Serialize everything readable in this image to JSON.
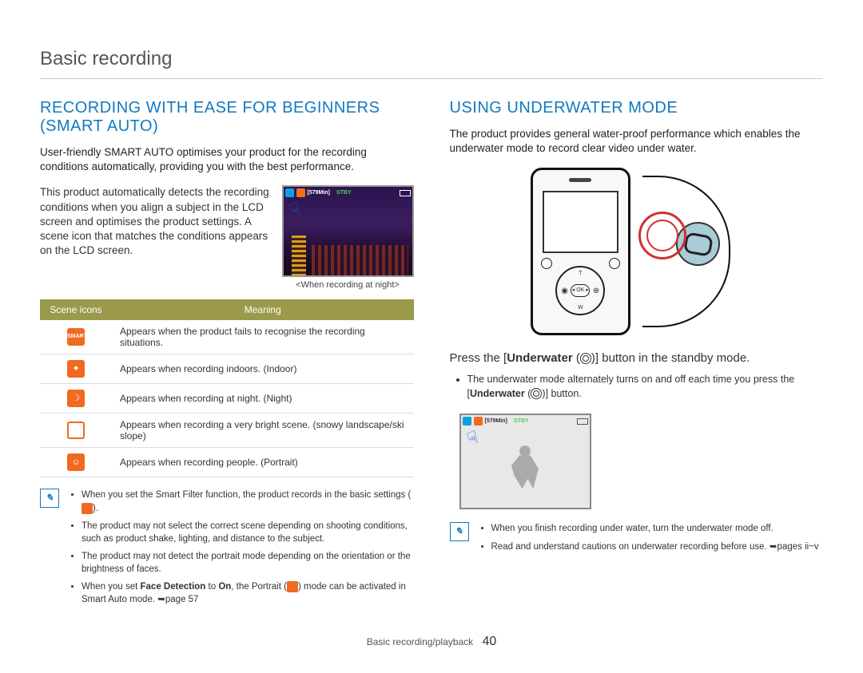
{
  "page_title": "Basic recording",
  "left": {
    "heading": "RECORDING WITH EASE FOR BEGINNERS (SMART AUTO)",
    "intro": "User-friendly SMART AUTO optimises your product for the recording conditions automatically, providing you with the best performance.",
    "auto_detect_text": "This product automatically detects the recording conditions when you align a subject in the LCD screen and optimises the product settings. A scene icon that matches the conditions appears on the LCD screen.",
    "lcd": {
      "time": "[579Min]",
      "stby": "STBY"
    },
    "caption": "<When recording at night>",
    "table": {
      "header1": "Scene icons",
      "header2": "Meaning",
      "rows": [
        {
          "icon": "SMART",
          "meaning": "Appears when the product fails to recognise the recording situations."
        },
        {
          "icon": "indoor",
          "meaning": "Appears when recording indoors. (Indoor)"
        },
        {
          "icon": "night",
          "meaning": "Appears when recording at night. (Night)"
        },
        {
          "icon": "white",
          "meaning": "Appears when recording a very bright scene. (snowy landscape/ski slope)"
        },
        {
          "icon": "portrait",
          "meaning": "Appears when recording people. (Portrait)"
        }
      ]
    },
    "notes": [
      "When you set the Smart Filter function, the product records in the basic settings (  ).",
      "The product may not select the correct scene depending on shooting conditions, such as product shake, lighting, and distance to the subject.",
      "The product may not detect the portrait mode depending on the orientation or the brightness of faces.",
      "When you set Face Detection to On, the Portrait (  ) mode can be activated in Smart Auto mode. ➥page 57"
    ],
    "note4_bold1": "Face Detection",
    "note4_bold2": "On"
  },
  "right": {
    "heading": "USING UNDERWATER MODE",
    "intro": "The product provides general water-proof performance which enables the underwater mode to record clear video under water.",
    "press_line_pre": "Press the [",
    "press_line_bold": "Underwater",
    "press_line_post": " (  )] button in the standby mode.",
    "bullet1_pre": "The underwater mode alternately turns on and off each time you press the [",
    "bullet1_bold": "Underwater",
    "bullet1_post": " (  )] button.",
    "uw_lcd": {
      "time": "[579Min]",
      "stby": "STBY"
    },
    "notes": [
      "When you finish recording under water, turn the underwater mode off.",
      "Read and understand cautions on underwater recording before use. ➥pages ii~v"
    ]
  },
  "footer": {
    "section": "Basic recording/playback",
    "page": "40"
  }
}
